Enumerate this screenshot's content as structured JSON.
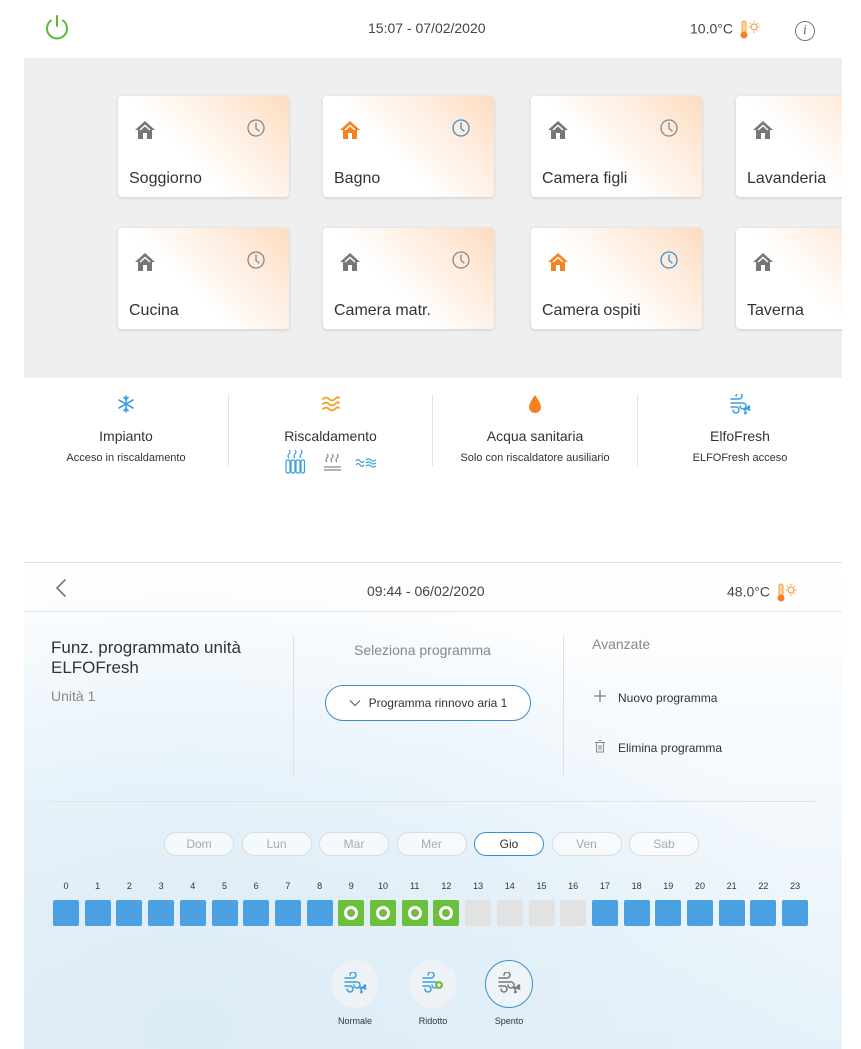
{
  "home": {
    "datetime": "15:07 - 07/02/2020",
    "temperature": "10.0°C",
    "rooms": [
      {
        "name": "Soggiorno",
        "active": false
      },
      {
        "name": "Bagno",
        "active": true
      },
      {
        "name": "Camera figli",
        "active": false
      },
      {
        "name": "Lavanderia",
        "active": false
      },
      {
        "name": "Cucina",
        "active": false
      },
      {
        "name": "Camera matr.",
        "active": false
      },
      {
        "name": "Camera ospiti",
        "active": true
      },
      {
        "name": "Taverna",
        "active": false
      }
    ],
    "modes": [
      {
        "title": "Impianto",
        "subtitle": "Acceso in riscaldamento",
        "icon": "snowflake-icon"
      },
      {
        "title": "Riscaldamento",
        "subtitle": "",
        "icon": "heat-waves-icon"
      },
      {
        "title": "Acqua sanitaria",
        "subtitle": "Solo con riscaldatore ausiliario",
        "icon": "water-drop-icon"
      },
      {
        "title": "ElfoFresh",
        "subtitle": "ELFOFresh acceso",
        "icon": "fan-icon"
      }
    ],
    "colors": {
      "active_house": "#f5821f",
      "inactive_house": "#777777",
      "active_clock": "#3b8fd0",
      "inactive_clock": "#888888"
    }
  },
  "program": {
    "datetime": "09:44 - 06/02/2020",
    "temperature": "48.0°C",
    "title": "Funz. programmato unità ELFOFresh",
    "unit": "Unità 1",
    "select_label": "Seleziona programma",
    "selected_program": "Programma rinnovo aria 1",
    "advanced_label": "Avanzate",
    "new_program": "Nuovo programma",
    "delete_program": "Elimina programma",
    "days": [
      "Dom",
      "Lun",
      "Mar",
      "Mer",
      "Gio",
      "Ven",
      "Sab"
    ],
    "active_day": "Gio",
    "hours": [
      "0",
      "1",
      "2",
      "3",
      "4",
      "5",
      "6",
      "7",
      "8",
      "9",
      "10",
      "11",
      "12",
      "13",
      "14",
      "15",
      "16",
      "17",
      "18",
      "19",
      "20",
      "21",
      "22",
      "23"
    ],
    "schedule": [
      "normale",
      "normale",
      "normale",
      "normale",
      "normale",
      "normale",
      "normale",
      "normale",
      "normale",
      "ridotto",
      "ridotto",
      "ridotto",
      "ridotto",
      "spento",
      "spento",
      "spento",
      "spento",
      "normale",
      "normale",
      "normale",
      "normale",
      "normale",
      "normale",
      "normale"
    ],
    "legend": [
      {
        "label": "Normale",
        "mode": "normale"
      },
      {
        "label": "Ridotto",
        "mode": "ridotto"
      },
      {
        "label": "Spento",
        "mode": "spento"
      }
    ],
    "selected_legend": "spento",
    "colors": {
      "normale": "#4aa0e0",
      "ridotto": "#6cbf3f",
      "spento": "#e2e2e2",
      "accent": "#3b8fd0"
    }
  }
}
